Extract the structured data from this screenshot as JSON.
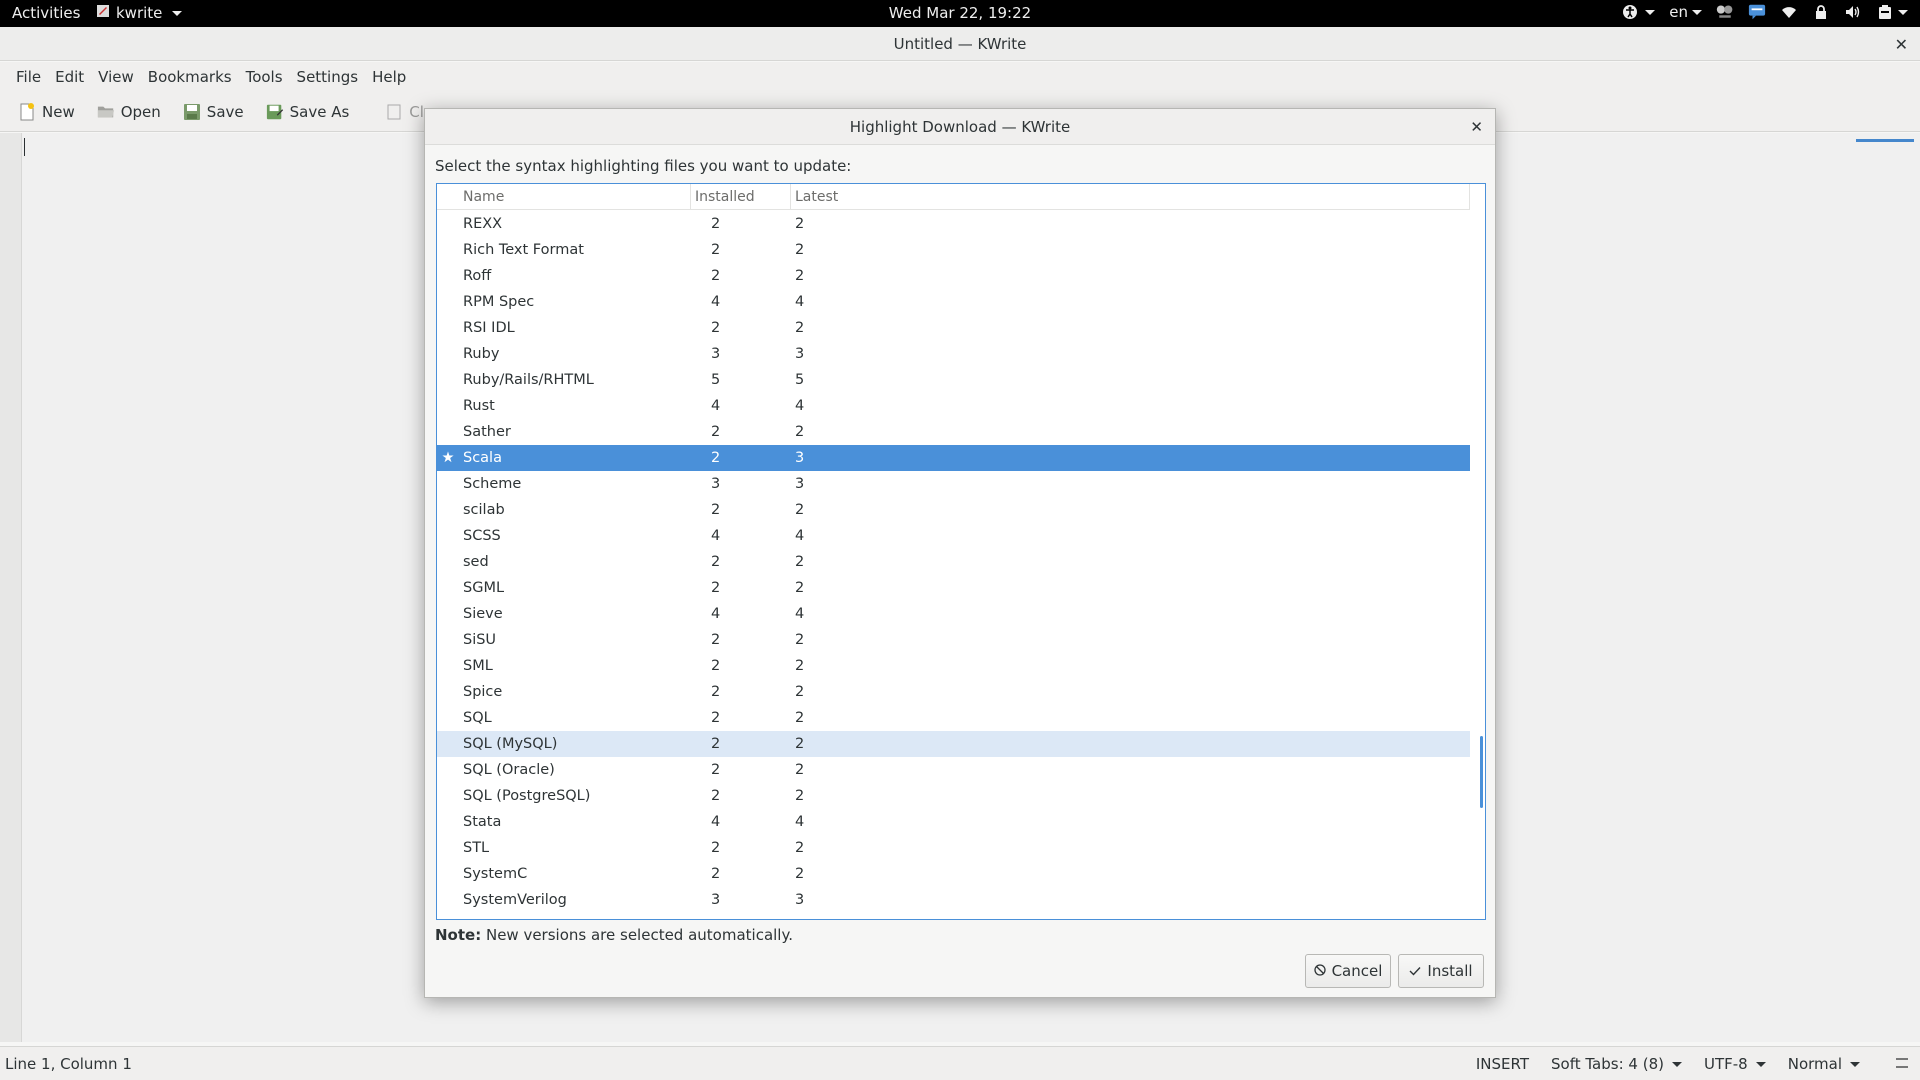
{
  "topbar": {
    "activities": "Activities",
    "app_name": "kwrite",
    "clock": "Wed Mar 22, 19:22",
    "language": "en",
    "icons": [
      "accessibility-icon",
      "battery-indicator-icon",
      "chat-icon",
      "wifi-icon",
      "lock-icon",
      "volume-icon",
      "system-menu-icon"
    ]
  },
  "window": {
    "title": "Untitled  — KWrite"
  },
  "menubar": {
    "items": [
      "File",
      "Edit",
      "View",
      "Bookmarks",
      "Tools",
      "Settings",
      "Help"
    ]
  },
  "toolbar": {
    "new": "New",
    "open": "Open",
    "save": "Save",
    "save_as": "Save As",
    "close": "Clo"
  },
  "statusbar": {
    "position": "Line 1, Column 1",
    "mode": "INSERT",
    "indent": "Soft Tabs: 4 (8)",
    "encoding": "UTF-8",
    "highlight": "Normal"
  },
  "dialog": {
    "title": "Highlight Download — KWrite",
    "prompt": "Select the syntax highlighting files you want to update:",
    "columns": {
      "name": "Name",
      "installed": "Installed",
      "latest": "Latest"
    },
    "rows": [
      {
        "name": "REXX",
        "installed": "2",
        "latest": "2"
      },
      {
        "name": "Rich Text Format",
        "installed": "2",
        "latest": "2"
      },
      {
        "name": "Roff",
        "installed": "2",
        "latest": "2"
      },
      {
        "name": "RPM Spec",
        "installed": "4",
        "latest": "4"
      },
      {
        "name": "RSI IDL",
        "installed": "2",
        "latest": "2"
      },
      {
        "name": "Ruby",
        "installed": "3",
        "latest": "3"
      },
      {
        "name": "Ruby/Rails/RHTML",
        "installed": "5",
        "latest": "5"
      },
      {
        "name": "Rust",
        "installed": "4",
        "latest": "4"
      },
      {
        "name": "Sather",
        "installed": "2",
        "latest": "2"
      },
      {
        "name": "Scala",
        "installed": "2",
        "latest": "3",
        "mark": "★",
        "state": "selected"
      },
      {
        "name": "Scheme",
        "installed": "3",
        "latest": "3"
      },
      {
        "name": "scilab",
        "installed": "2",
        "latest": "2"
      },
      {
        "name": "SCSS",
        "installed": "4",
        "latest": "4"
      },
      {
        "name": "sed",
        "installed": "2",
        "latest": "2"
      },
      {
        "name": "SGML",
        "installed": "2",
        "latest": "2"
      },
      {
        "name": "Sieve",
        "installed": "4",
        "latest": "4"
      },
      {
        "name": "SiSU",
        "installed": "2",
        "latest": "2"
      },
      {
        "name": "SML",
        "installed": "2",
        "latest": "2"
      },
      {
        "name": "Spice",
        "installed": "2",
        "latest": "2"
      },
      {
        "name": "SQL",
        "installed": "2",
        "latest": "2"
      },
      {
        "name": "SQL (MySQL)",
        "installed": "2",
        "latest": "2",
        "state": "hover"
      },
      {
        "name": "SQL (Oracle)",
        "installed": "2",
        "latest": "2"
      },
      {
        "name": "SQL (PostgreSQL)",
        "installed": "2",
        "latest": "2"
      },
      {
        "name": "Stata",
        "installed": "4",
        "latest": "4"
      },
      {
        "name": "STL",
        "installed": "2",
        "latest": "2"
      },
      {
        "name": "SystemC",
        "installed": "2",
        "latest": "2"
      },
      {
        "name": "SystemVerilog",
        "installed": "3",
        "latest": "3"
      }
    ],
    "note_label": "Note:",
    "note_text": " New versions are selected automatically.",
    "cancel": "Cancel",
    "install": "Install"
  },
  "colors": {
    "accent": "#4a90d9",
    "hover": "#dce8f6"
  }
}
